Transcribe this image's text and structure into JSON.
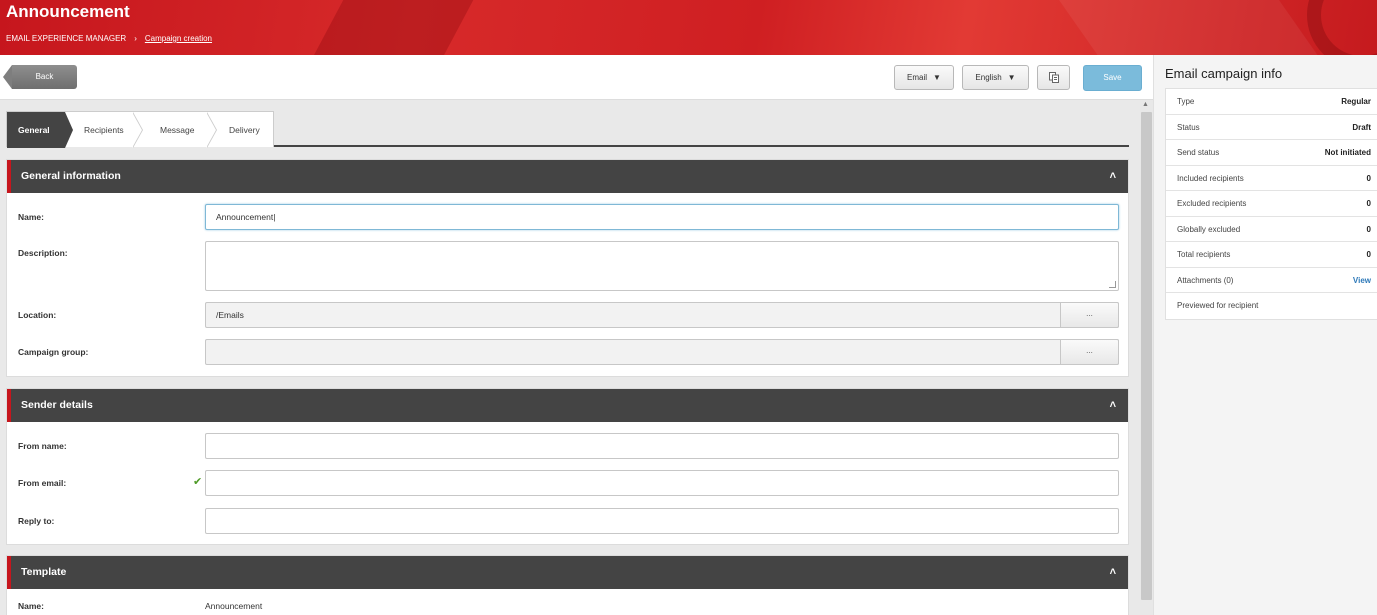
{
  "header": {
    "title": "Announcement",
    "breadcrumb": [
      "EMAIL EXPERIENCE MANAGER",
      "Campaign creation"
    ],
    "breadcrumb_separator": "›"
  },
  "toolbar": {
    "back_label": "Back",
    "type_select": "Email",
    "language_select": "English",
    "copy_icon": "copy-icon",
    "save_label": "Save"
  },
  "tabs": [
    {
      "label": "General",
      "active": true
    },
    {
      "label": "Recipients",
      "active": false
    },
    {
      "label": "Message",
      "active": false
    },
    {
      "label": "Delivery",
      "active": false
    }
  ],
  "general_info": {
    "heading": "General information",
    "name_label": "Name:",
    "name_value": "Announcement",
    "description_label": "Description:",
    "description_value": "",
    "location_label": "Location:",
    "location_value": "/Emails",
    "campaign_group_label": "Campaign group:",
    "campaign_group_value": "",
    "ellipsis": "..."
  },
  "sender_details": {
    "heading": "Sender details",
    "from_name_label": "From name:",
    "from_name_value": "",
    "from_email_label": "From email:",
    "from_email_value": "",
    "reply_to_label": "Reply to:",
    "reply_to_value": ""
  },
  "template": {
    "heading": "Template",
    "name_label": "Name:",
    "name_value": "Announcement"
  },
  "side": {
    "title": "Email campaign info",
    "rows": [
      {
        "key": "Type",
        "value": "Regular"
      },
      {
        "key": "Status",
        "value": "Draft"
      },
      {
        "key": "Send status",
        "value": "Not initiated"
      },
      {
        "key": "Included recipients",
        "value": "0"
      },
      {
        "key": "Excluded recipients",
        "value": "0"
      },
      {
        "key": "Globally excluded",
        "value": "0"
      },
      {
        "key": "Total recipients",
        "value": "0"
      },
      {
        "key": "Attachments (0)",
        "value": "View"
      },
      {
        "key": "Previewed for recipient",
        "value": ""
      }
    ]
  },
  "colors": {
    "brand_red": "#c6161d",
    "panel_dark": "#444444",
    "save_blue": "#7bbbdb",
    "link_blue": "#2f7ab9",
    "check_green": "#4e9a26"
  }
}
